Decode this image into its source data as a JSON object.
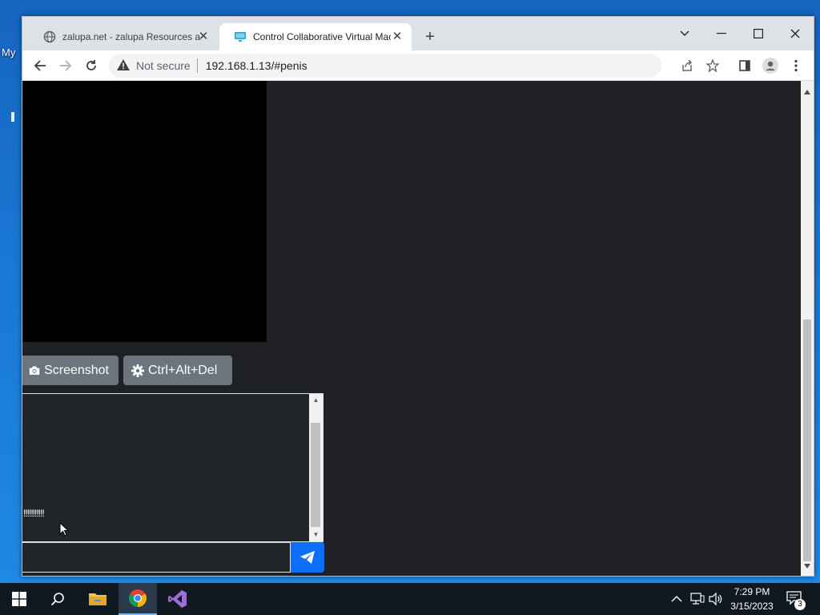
{
  "desktop": {
    "label": "My"
  },
  "browser": {
    "tabs": [
      {
        "title": "zalupa.net - zalupa Resources and",
        "favicon": "globe-icon",
        "active": false
      },
      {
        "title": "Control Collaborative Virtual Machine",
        "favicon": "monitor-icon",
        "active": true
      }
    ],
    "security_label": "Not secure",
    "url": "192.168.1.13/#penis"
  },
  "page": {
    "screenshot_label": "Screenshot",
    "ctrl_alt_del_label": "Ctrl+Alt+Del",
    "chat_lines": [
      "!!!!!!!!!!!"
    ],
    "chat_input_value": "",
    "send_icon": "paper-plane-icon",
    "colors": {
      "button": "#6c757d",
      "send": "#0d6efd",
      "background": "#202124"
    }
  },
  "taskbar": {
    "time": "7:29 PM",
    "date": "3/15/2023",
    "notification_count": "3"
  }
}
